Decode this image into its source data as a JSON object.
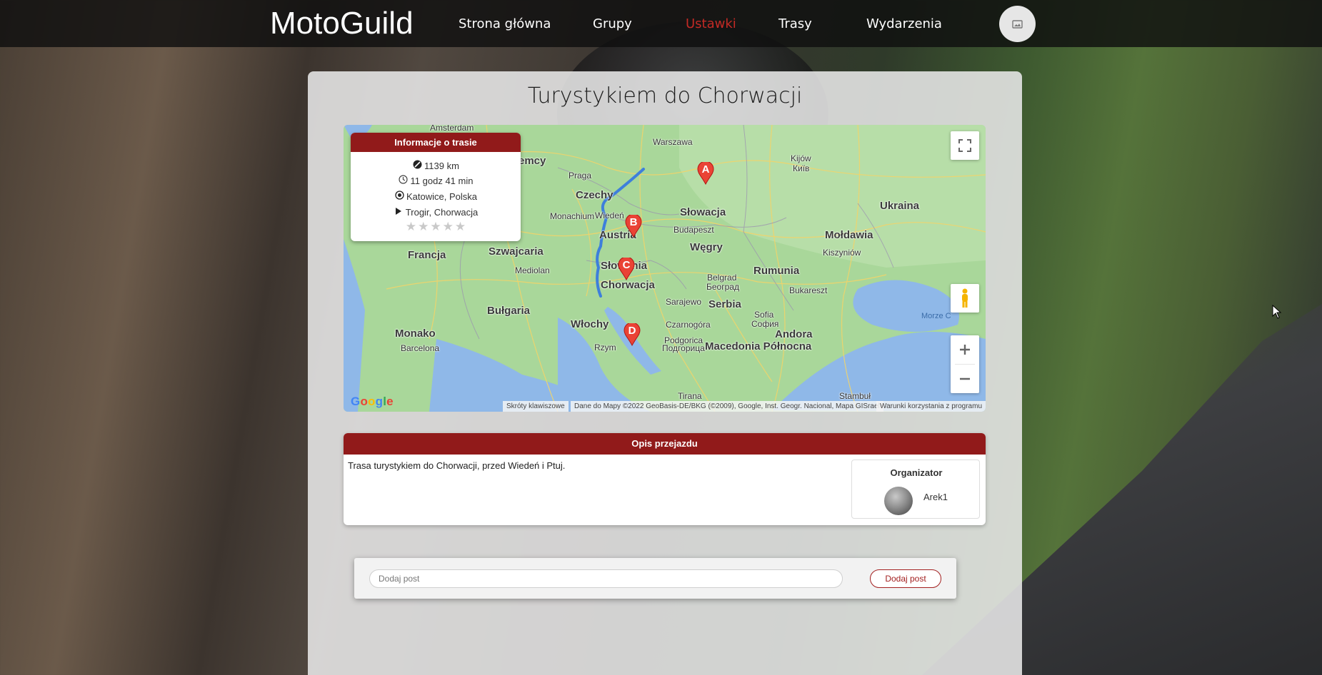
{
  "nav": {
    "logo": "MotoGuild",
    "links": [
      "Strona główna",
      "Grupy",
      "Ustawki",
      "Trasy",
      "Wydarzenia"
    ],
    "active": "Ustawki",
    "accent_color": "#c32a25"
  },
  "page": {
    "title": "Turystykiem do Chorwacji"
  },
  "map": {
    "labels": {
      "countries": [
        "Niemcy",
        "Czechy",
        "Słowacja",
        "Ukraina",
        "Austria",
        "Węgry",
        "Mołdawia",
        "Francja",
        "Szwajcaria",
        "Słowenia",
        "Rumunia",
        "Chorwacja",
        "Serbia",
        "Bułgaria",
        "Monako",
        "Włochy",
        "Andora",
        "Macedonia Północna"
      ],
      "cities": [
        "Amsterdam",
        "Warszawa",
        "Kijów",
        "Київ",
        "Praga",
        "Monachium",
        "Wiedeń",
        "Budapeszt",
        "Kiszyniów",
        "Mediolan",
        "Belgrad",
        "Београд",
        "Bukareszt",
        "Sarajewo",
        "Sofia",
        "София",
        "Czarnogóra",
        "Podgorica",
        "Подгорица",
        "Rzym",
        "Barcelona",
        "Tirana",
        "Stambuł"
      ],
      "seas": [
        "Morze C"
      ]
    },
    "markers": [
      "A",
      "B",
      "C",
      "D"
    ],
    "footer": {
      "shortcuts": "Skróty klawiszowe",
      "attribution": "Dane do Mapy ©2022 GeoBasis-DE/BKG (©2009), Google, Inst. Geogr. Nacional, Mapa GISrael",
      "terms": "Warunki korzystania z programu"
    },
    "google": "Google",
    "controls": [
      "fullscreen-icon",
      "pegman-icon",
      "zoom-in-icon",
      "zoom-out-icon"
    ]
  },
  "route_info": {
    "title": "Informacje o trasie",
    "distance": "1139 km",
    "duration": "11 godz 41 min",
    "start": "Katowice, Polska",
    "end": "Trogir, Chorwacja",
    "rating": 0,
    "rating_max": 5,
    "header_color": "#911a1a"
  },
  "description": {
    "title": "Opis przejazdu",
    "text": "Trasa turystykiem do Chorwacji, przed Wiedeń i Ptuj.",
    "organizer_label": "Organizator",
    "organizer_name": "Arek1"
  },
  "post": {
    "placeholder": "Dodaj post",
    "button": "Dodaj post"
  }
}
